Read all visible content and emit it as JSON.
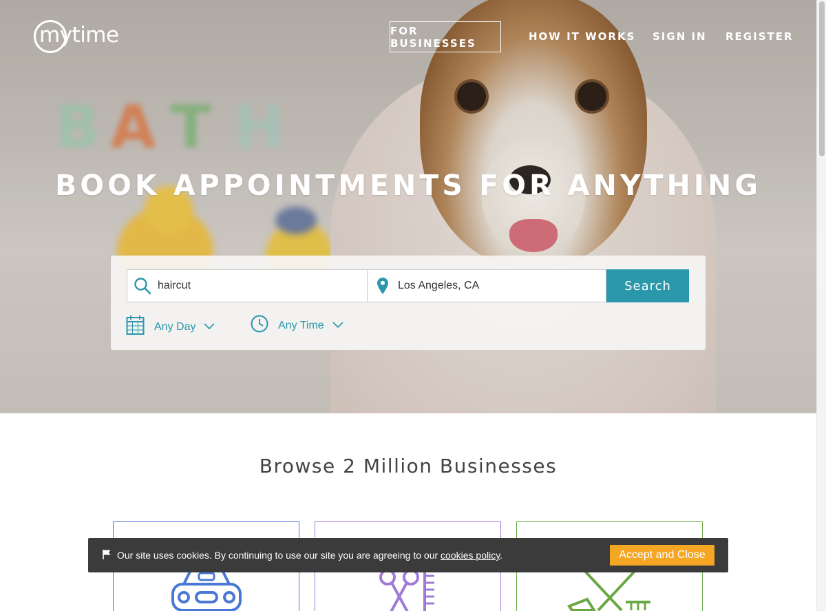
{
  "brand": {
    "logo_text": "mytime"
  },
  "nav": {
    "for_businesses": "FOR BUSINESSES",
    "how_it_works": "HOW IT WORKS",
    "sign_in": "SIGN IN",
    "register": "REGISTER"
  },
  "hero": {
    "headline": "BOOK APPOINTMENTS FOR ANYTHING",
    "background_letters": [
      "B",
      "A",
      "T",
      "H"
    ]
  },
  "search": {
    "what_value": "haircut",
    "where_value": "Los Angeles, CA",
    "button_label": "Search",
    "day_filter": "Any Day",
    "time_filter": "Any Time",
    "accent_color": "#2a97aa"
  },
  "browse": {
    "title": "Browse 2 Million Businesses",
    "categories": [
      {
        "icon": "car-icon",
        "color": "#4a78d6"
      },
      {
        "icon": "scissors-comb-icon",
        "color": "#a07ad8"
      },
      {
        "icon": "pet-grooming-icon",
        "color": "#6aa843"
      }
    ]
  },
  "cookie": {
    "text_before": "Our site uses cookies. By continuing to use our site you are agreeing to our ",
    "link_text": "cookies policy",
    "text_after": ".",
    "accept_label": "Accept and Close",
    "accept_color": "#f5a623"
  }
}
